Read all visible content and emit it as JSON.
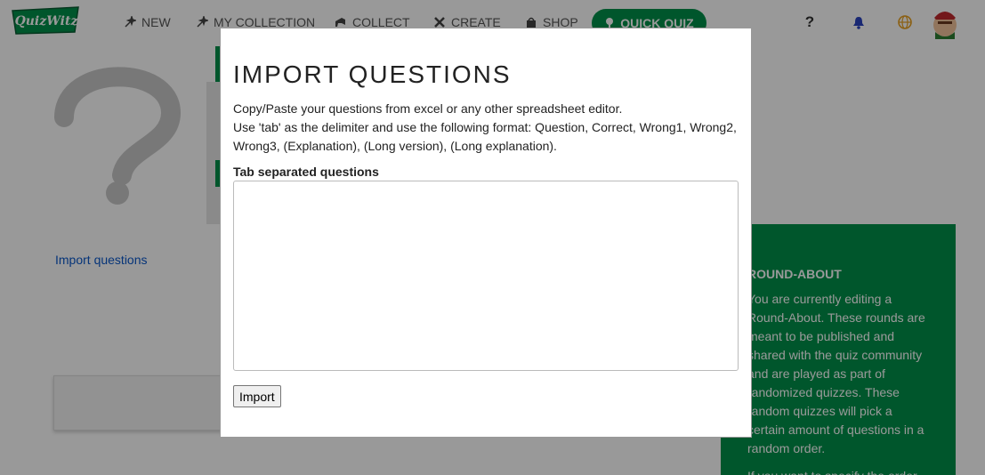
{
  "brand": {
    "logo_text": "QuizWitz"
  },
  "nav": {
    "items": [
      {
        "label": "NEW",
        "icon": "sparkle-icon"
      },
      {
        "label": "MY COLLECTION",
        "icon": "cards-icon"
      },
      {
        "label": "COLLECT",
        "icon": "megaphone-icon"
      },
      {
        "label": "CREATE",
        "icon": "tools-icon"
      },
      {
        "label": "SHOP",
        "icon": "bag-icon"
      }
    ],
    "quick_quiz_label": "QUICK QUIZ",
    "help_glyph": "?",
    "accent": "#00904a"
  },
  "background": {
    "import_link": "Import questions",
    "side_title": "ROUND-ABOUT",
    "side_text": "You are currently editing a Round-About. These rounds are meant to be published and shared with the quiz community and are played as part of randomized quizzes. These random quizzes will pick a certain amount of questions in a random order.",
    "side_text_more": "If you want to specify the order"
  },
  "modal": {
    "title": "IMPORT QUESTIONS",
    "desc_line1": "Copy/Paste your questions from excel or any other spreadsheet editor.",
    "desc_line2": "Use 'tab' as the delimiter and use the following format: Question, Correct, Wrong1, Wrong2, Wrong3, (Explanation), (Long version), (Long explanation).",
    "field_label": "Tab separated questions",
    "textarea_value": "",
    "import_button": "Import"
  }
}
